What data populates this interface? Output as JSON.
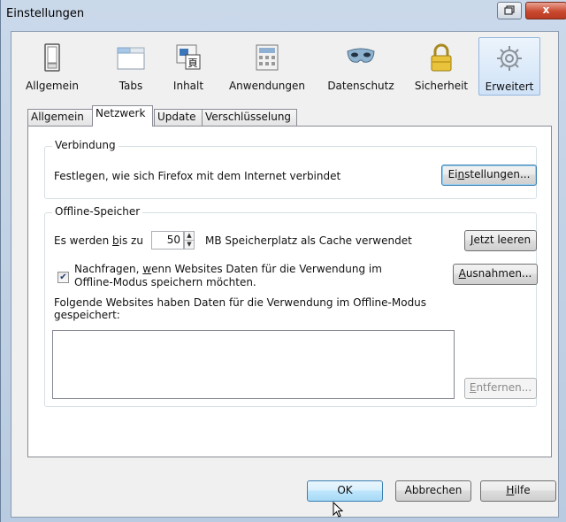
{
  "window": {
    "title": "Einstellungen",
    "restore_icon": "restore-icon",
    "close_icon": "close-icon",
    "close_glyph": "x"
  },
  "panes": [
    {
      "label": "Allgemein",
      "icon": "switch-icon"
    },
    {
      "label": "Tabs",
      "icon": "tabs-icon"
    },
    {
      "label": "Inhalt",
      "icon": "content-icon"
    },
    {
      "label": "Anwendungen",
      "icon": "applications-icon"
    },
    {
      "label": "Datenschutz",
      "icon": "mask-icon"
    },
    {
      "label": "Sicherheit",
      "icon": "lock-icon"
    },
    {
      "label": "Erweitert",
      "icon": "gear-icon",
      "selected": true
    }
  ],
  "tabs": [
    {
      "label": "Allgemein"
    },
    {
      "label": "Netzwerk",
      "active": true
    },
    {
      "label": "Update"
    },
    {
      "label": "Verschlüsselung"
    }
  ],
  "verbindung": {
    "caption": "Verbindung",
    "text": "Festlegen, wie sich Firefox mit dem Internet verbindet",
    "button": {
      "before": "Ei",
      "access": "n",
      "after": "stellungen..."
    }
  },
  "offline": {
    "caption": "Offline-Speicher",
    "limit_before": "Es werden ",
    "limit_access": "b",
    "limit_after": "is zu",
    "limit_value": "50",
    "limit_unit": "MB Speicherplatz als Cache verwendet",
    "clear_button": {
      "access": "J",
      "after": "etzt leeren"
    },
    "ask_checked": true,
    "ask_line1_before": "Nachfragen, ",
    "ask_line1_access": "w",
    "ask_line1_after": "enn Websites Daten für die Verwendung im",
    "ask_line2": "Offline-Modus speichern möchten.",
    "exceptions_button": {
      "access": "A",
      "after": "usnahmen..."
    },
    "sites_label_line1": "Folgende Websites haben Daten für die Verwendung im Offline-Modus",
    "sites_label_line2": "gespeichert:",
    "remove_button": {
      "access": "E",
      "after": "ntfernen..."
    }
  },
  "footer": {
    "ok": "OK",
    "cancel": "Abbrechen",
    "help": {
      "access": "H",
      "after": "ilfe"
    }
  },
  "colors": {
    "accent": "#3c7fb1",
    "window_frame": "#c3d3e6",
    "close_red": "#c9492f"
  }
}
